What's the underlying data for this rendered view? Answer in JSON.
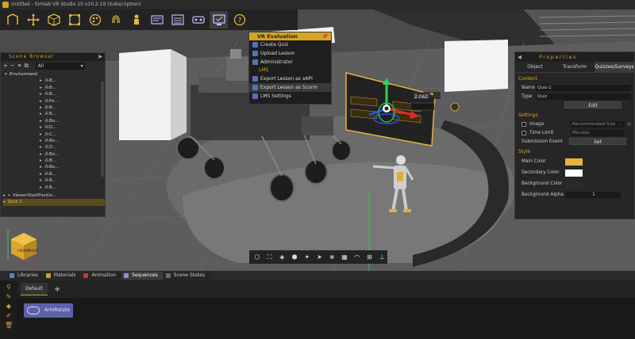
{
  "window": {
    "title": "Untitled - Simlab VR Studio 10 v10.2.19 (Subscription)"
  },
  "toolbar": {
    "buttons": [
      {
        "name": "import-icon",
        "glyph": "⊓"
      },
      {
        "name": "move-icon",
        "glyph": "✥"
      },
      {
        "name": "cube-icon",
        "glyph": "⬡"
      },
      {
        "name": "select-icon",
        "glyph": "⬚"
      },
      {
        "name": "materials-icon",
        "glyph": "◉"
      },
      {
        "name": "fingerprint-icon",
        "glyph": "☋"
      },
      {
        "name": "avatar-icon",
        "glyph": "♙"
      },
      {
        "name": "timeline-icon",
        "glyph": "▤"
      },
      {
        "name": "list-icon",
        "glyph": "☰"
      },
      {
        "name": "vr-headset-icon",
        "glyph": "◙"
      },
      {
        "name": "vr-evaluation-icon",
        "glyph": "▣"
      },
      {
        "name": "help-icon",
        "glyph": "?"
      }
    ]
  },
  "vr_menu": {
    "title": "VR Evaluation",
    "items": [
      {
        "label": "Create Quiz",
        "icon": "quiz-icon"
      },
      {
        "label": "Upload Lesson",
        "icon": "upload-icon"
      },
      {
        "label": "Administrator",
        "icon": "admin-icon"
      }
    ],
    "lms_section": "LMS",
    "lms_items": [
      {
        "label": "Export Lesson as xAPI",
        "icon": "xapi-icon"
      },
      {
        "label": "Export Lesson as Scorm",
        "icon": "scorm-icon"
      },
      {
        "label": "LMS Settings",
        "icon": "settings-icon"
      }
    ]
  },
  "scene_browser": {
    "title": "Scene Browser",
    "filter": "All",
    "environment_label": "Environment",
    "children": [
      "B...",
      "B...",
      "B...",
      "Fe...",
      "B...",
      "B...",
      "Bo...",
      "D...",
      "C...",
      "Bo...",
      "D...",
      "Bo...",
      "B...",
      "Bo...",
      "B...",
      "B...",
      "B..."
    ],
    "viewer_row": "ViewerStartPositio...",
    "selected_row": "Quiz-1"
  },
  "gizmo": {
    "value": "2.062"
  },
  "properties": {
    "title": "Properties",
    "tabs": [
      "Object",
      "Transform",
      "Quizzes/Surveys"
    ],
    "active_tab": 2,
    "content_label": "Content",
    "name_label": "Name",
    "name_value": "Quiz-1",
    "type_label": "Type",
    "type_value": "Quiz",
    "edit_label": "Edit",
    "settings_label": "Settings",
    "image_label": "Image",
    "image_value": "Recommended Size ...",
    "time_limit_label": "Time Limit",
    "time_limit_value": "Minutes",
    "submission_label": "Submission Event",
    "set_label": "Set",
    "style_label": "Style",
    "main_color_label": "Main Color",
    "secondary_color_label": "Secondary Color",
    "background_color_label": "Background Color",
    "background_alpha_label": "Background Alpha",
    "background_alpha_value": "1",
    "colors": {
      "main": "#e8b33a",
      "secondary": "#ffffff",
      "background": "#2a2a2a"
    }
  },
  "bottom_tabs": [
    {
      "label": "Libraries",
      "color": "#5a7fc4"
    },
    {
      "label": "Materials",
      "color": "#c9a227"
    },
    {
      "label": "Animation",
      "color": "#c23b3b"
    },
    {
      "label": "Sequences",
      "color": "#8a8fd6"
    },
    {
      "label": "Scene States",
      "color": "#6c6c6c"
    }
  ],
  "active_bottom_tab": 3,
  "sequences": {
    "tab": "Default",
    "add": "+",
    "item": "ArmRotate"
  },
  "accent": "#d7a326"
}
